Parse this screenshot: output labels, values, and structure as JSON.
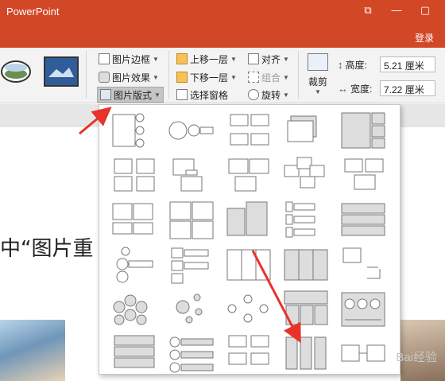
{
  "app": {
    "title": "PowerPoint"
  },
  "window_controls": [
    "⧉",
    "—",
    "▢"
  ],
  "account": {
    "login_label": "登录"
  },
  "ribbon": {
    "picture_border": "图片边框",
    "picture_effects": "图片效果",
    "picture_layout": "图片版式",
    "bring_forward": "上移一层",
    "send_backward": "下移一层",
    "selection_pane": "选择窗格",
    "align": "对齐",
    "group": "组合",
    "rotate": "旋转",
    "crop": "裁剪",
    "height_label": "高度:",
    "height_value": "5.21 厘米",
    "width_label": "宽度:",
    "width_value": "7.22 厘米",
    "launcher": "⌟"
  },
  "slide": {
    "text": "中“图片重"
  },
  "layout_gallery": {
    "columns": 5,
    "rows": 6,
    "items": [
      "vertical-picture-list",
      "circle-accent-timeline",
      "picture-grid-alt",
      "snapshot-picture-list",
      "title-picture-blocks",
      "picture-caption-list",
      "picture-captions-offset",
      "picture-grid-caption",
      "bending-picture-blocks",
      "bending-picture-caption",
      "picture-list-horizontal",
      "picture-quad",
      "picture-stack",
      "picture-vertical-list",
      "picture-rows",
      "circle-picture-hierarchy",
      "circle-stacked-list",
      "bending-picture-strip",
      "picture-columns-caption",
      "framed-picture",
      "hexagon-cluster",
      "circle-radial",
      "circle-branch-hierarchy",
      "picture-columns",
      "picture-accent-process",
      "vertical-bullet-blocks",
      "circle-list-blocks",
      "picture-caption-blocks",
      "vertical-picture-columns",
      "picture-connected"
    ]
  },
  "colors": {
    "accent": "#d24726",
    "ribbon_bg": "#f3f3f3",
    "arrow": "#e8332a"
  }
}
